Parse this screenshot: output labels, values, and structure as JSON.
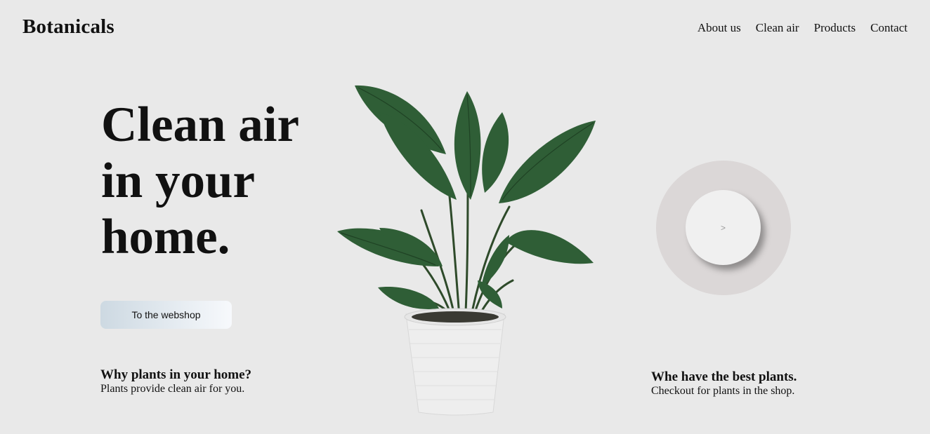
{
  "brand": {
    "logo_text": "Botanicals"
  },
  "nav": {
    "items": [
      "About us",
      "Clean air",
      "Products",
      "Contact"
    ]
  },
  "hero": {
    "headline_line1": "Clean air",
    "headline_line2": "in your",
    "headline_line3": "home.",
    "cta_label": "To the webshop"
  },
  "info_left": {
    "title": "Why plants in your home?",
    "subtitle": "Plants provide clean air for you."
  },
  "info_right": {
    "title": "Whe have the best plants.",
    "subtitle": "Checkout for plants in the shop."
  },
  "carousel": {
    "next_label": ">"
  },
  "icons": {
    "plant": "potted-plant-image",
    "next": "next-arrow-icon"
  },
  "colors": {
    "background": "#e9e9e9",
    "leaf": "#2f5e36",
    "pot": "#eeeeee",
    "ring": "#dbd7d7",
    "knob": "#f0f0f0"
  }
}
